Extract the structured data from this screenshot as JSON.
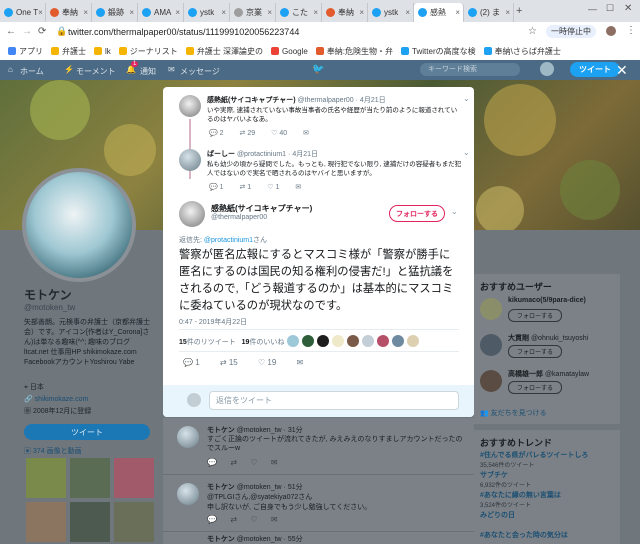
{
  "tabs": [
    {
      "label": "One T",
      "color": "#1da1f2"
    },
    {
      "label": "奉納",
      "color": "#e25b2c"
    },
    {
      "label": "鍛跡",
      "color": "#1da1f2"
    },
    {
      "label": "AMA",
      "color": "#1da1f2"
    },
    {
      "label": "ystk",
      "color": "#1da1f2"
    },
    {
      "label": "京業",
      "color": "#9e9e9e"
    },
    {
      "label": "こた",
      "color": "#1da1f2"
    },
    {
      "label": "奉納",
      "color": "#e25b2c"
    },
    {
      "label": "ystk",
      "color": "#1da1f2"
    },
    {
      "label": "感熱",
      "color": "#1da1f2"
    },
    {
      "label": "(2) ま",
      "color": "#1da1f2"
    }
  ],
  "window": {
    "pause_label": "一時停止中"
  },
  "address": {
    "url": "twitter.com/thermalpaper00/status/1119991020056223744"
  },
  "bookmarks": [
    "アプリ",
    "弁護士",
    "lk",
    "ジーナリスト",
    "弁護士 深澤論史の",
    "Google",
    "奉納:危険生物・弁",
    "Twitterの高度な検",
    "奉納\\さらば弁護士"
  ],
  "twitter_nav": {
    "home": "ホーム",
    "moments": "モーメント",
    "notifications": "通知",
    "notif_count": "1",
    "messages": "メッセージ",
    "search_placeholder": "キーワード検索",
    "tweet_button": "ツイート"
  },
  "profile": {
    "name": "モトケン",
    "handle": "@motoken_tw",
    "bio": "矢部善朗。元検事の弁護士（京都弁護士会）です。アイコン[作者はY_Corona]さん)は単なる趣味(^^; 趣味のブログ ltcat.net 仕事用HP shikimokaze.com FacebookアカウントYoshirou Yabe",
    "location": "日本",
    "website": "shikimokaze.com",
    "joined": "2008年12月に登録",
    "tweet_button": "ツイート",
    "media_label": "374 画像と動画"
  },
  "modal": {
    "context1": {
      "name": "感熱紙(サイコキャプチャー)",
      "handle": "@thermalpaper00",
      "date": "4月21日",
      "text": "いや実際, 逮捕されていない事故当事者の氏名や経歴が当たり前のように報道されているのはヤバいよなあ。",
      "replies": "2",
      "retweets": "29",
      "likes": "40"
    },
    "context2": {
      "name": "ぱーしー",
      "handle": "@protactinium1",
      "date": "4月21日",
      "text": "私も幼少の頃から疑問でした。もっとも, 現行犯でない限り, 逮捕だけの容疑者もまだ犯人ではないので実名で晒されるのはヤバイと思いますが。",
      "replies": "1",
      "retweets": "1",
      "likes": "1"
    },
    "main": {
      "name": "感熱紙(サイコキャプチャー)",
      "handle": "@thermalpaper00",
      "follow_label": "フォローする",
      "reply_to_prefix": "返信先:",
      "reply_to_handle": "@protactinium1",
      "reply_to_suffix": "さん",
      "text": "警察が匿名広報にするとマスコミ様が「警察が勝手に匿名にするのは国民の知る権利の侵害だ!」と猛抗議をされるので,「どう報道するのか」は基本的にマスコミに委ねているのが現状なのです。",
      "timestamp": "0:47 - 2019年4月22日",
      "retweet_count": "15",
      "retweet_label": "件のリツイート",
      "like_count": "19",
      "like_label": "件のいいね",
      "replies": "1",
      "retweets": "15",
      "likes": "19"
    },
    "reply_placeholder": "返信をツイート"
  },
  "timeline": [
    {
      "name": "モトケン",
      "handle": "@motoken_tw",
      "time": "31分",
      "text": "すごく正論のツイートが流れてきたが, みえみえのなりすましアカウントだったのでスルーw"
    },
    {
      "name": "モトケン",
      "handle": "@motoken_tw",
      "time": "51分",
      "text_prefix": "@TPLGIさん,",
      "text_mention": "@syatekiya072",
      "text_suffix": "さん",
      "text2": "申し訳ないが, ご自身でもう少し勉強してください。"
    },
    {
      "name": "モトケン",
      "handle": "@motoken_tw",
      "time": "55分",
      "text": ""
    }
  ],
  "recommend": {
    "title": "おすすめユーザー",
    "users": [
      {
        "name": "kikumaco(5/9para-dice)",
        "handle": "@kikumaco"
      },
      {
        "name": "大貫剛",
        "handle": "@ohnuki_tsuyoshi"
      },
      {
        "name": "高橋雄一郎",
        "handle": "@kamataylaw"
      }
    ],
    "follow_label": "フォローする",
    "find_friends": "友だちを見つける"
  },
  "trends": {
    "title": "おすすめトレンド",
    "items": [
      {
        "tag": "#住んでる県がバレるツイートしろ",
        "count": "35,546件のツイート"
      },
      {
        "tag": "サブチケ",
        "count": "6,932件のツイート"
      },
      {
        "tag": "#あなたに縁の無い言葉は",
        "count": "3,524件のツイート"
      },
      {
        "tag": "みどりの日",
        "count": ""
      },
      {
        "tag": "#あなたと会った時の気分は",
        "count": ""
      }
    ]
  }
}
